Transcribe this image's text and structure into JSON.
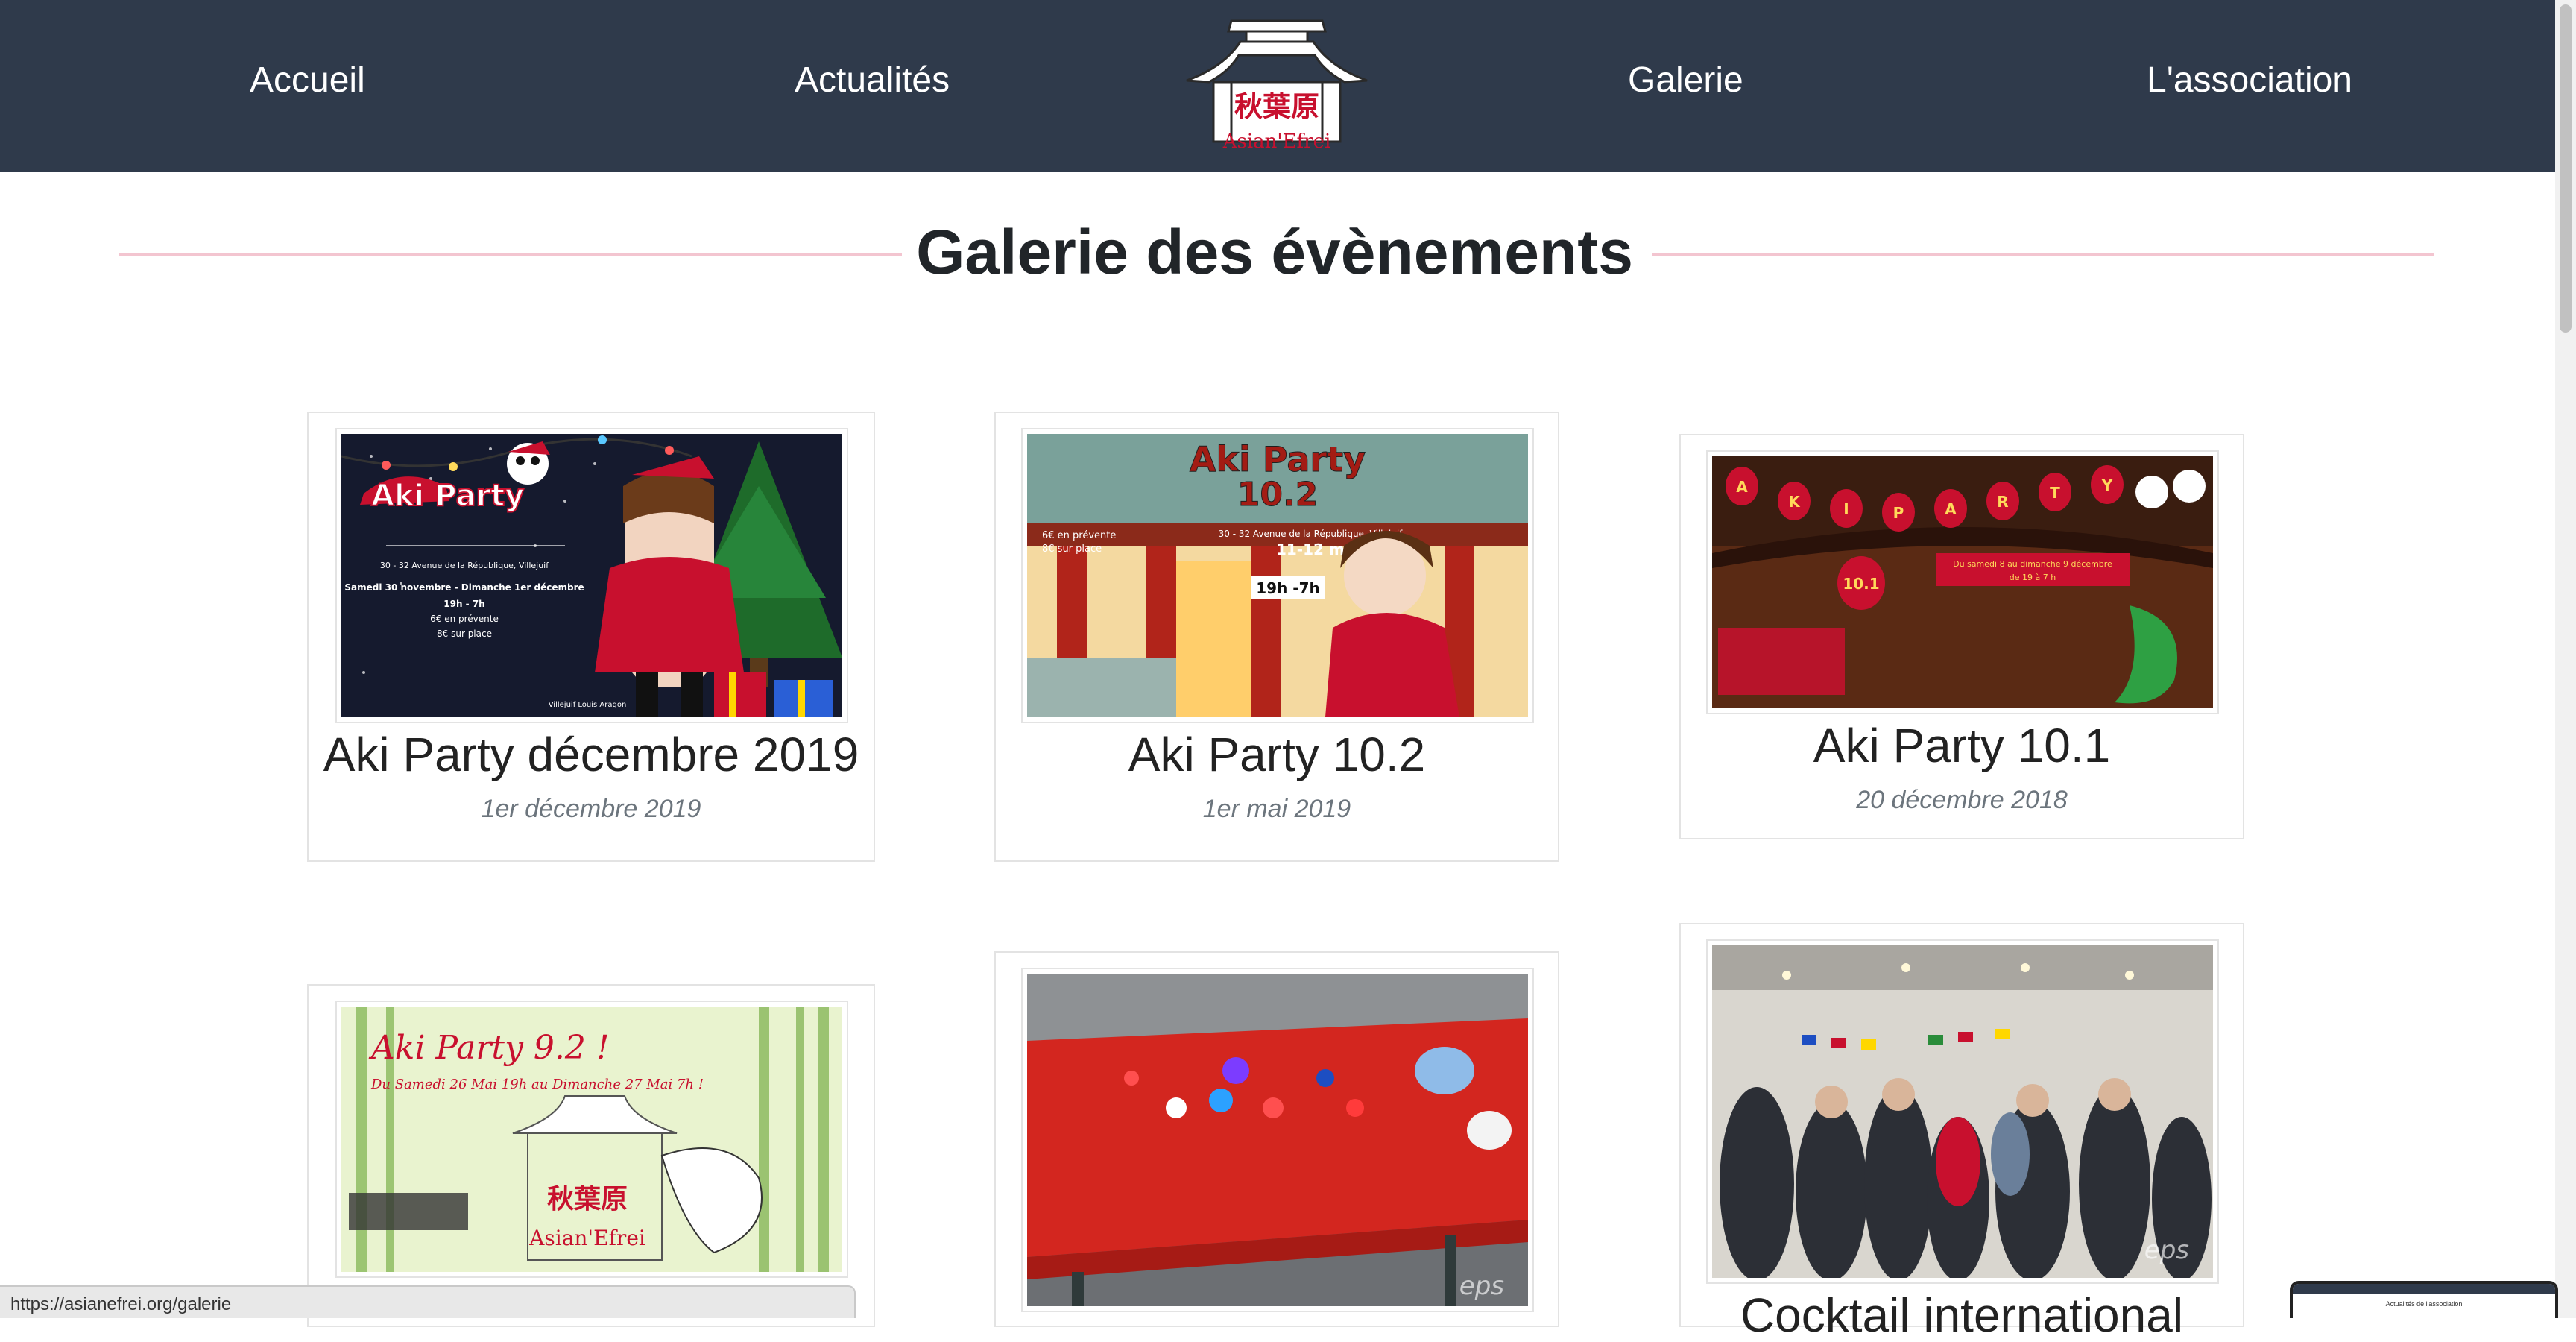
{
  "nav": {
    "items": [
      {
        "label": "Accueil"
      },
      {
        "label": "Actualités"
      },
      {
        "label": "Galerie"
      },
      {
        "label": "L'association"
      }
    ],
    "logo": {
      "kanji": "秋葉原",
      "name": "Asian'Efrei"
    }
  },
  "page": {
    "title": "Galerie des évènements"
  },
  "events": [
    {
      "title": "Aki Party décembre 2019",
      "date": "1er décembre 2019",
      "poster": {
        "heading": "Aki Party",
        "lines": [
          "30 - 32 Avenue de la République, Villejuif",
          "Samedi 30 novembre - Dimanche 1er décembre",
          "19h - 7h",
          "6€ en prévente",
          "8€ sur place"
        ],
        "footer": "Villejuif Louis Aragon"
      }
    },
    {
      "title": "Aki Party 10.2",
      "date": "1er mai 2019",
      "poster": {
        "heading": "Aki Party",
        "subheading": "10.2",
        "address": "30 - 32 Avenue de la République, Villejuif",
        "dates": "11-12 mai",
        "hours": "19h -7h",
        "prices": [
          "6€ en prévente",
          "8€ sur place"
        ]
      }
    },
    {
      "title": "Aki Party 10.1",
      "date": "20 décembre 2018",
      "poster": {
        "letters": [
          "A",
          "K",
          "I",
          "P",
          "A",
          "R",
          "T",
          "Y"
        ],
        "number": "10.1",
        "banner": [
          "Du samedi 8 au dimanche 9 décembre",
          "de 19 à 7 h"
        ]
      }
    },
    {
      "title": "",
      "date": "",
      "poster": {
        "heading": "Aki Party 9.2 !",
        "sub": "Du Samedi 26 Mai 19h au Dimanche 27 Mai 7h !",
        "kanji": "秋葉原",
        "name": "Asian'Efrei"
      }
    },
    {
      "title": "",
      "date": "",
      "poster": {
        "watermark": "eps"
      }
    },
    {
      "title": "Cocktail international",
      "date": "",
      "poster": {
        "watermark": "eps"
      }
    }
  ],
  "status_bar": {
    "url": "https://asianefrei.org/galerie"
  },
  "preview": {
    "caption": "Actualités de l'association"
  },
  "colors": {
    "navbar": "#2f3a4b",
    "title_line": "#f3c5d0",
    "accent_red": "#c8102e"
  }
}
